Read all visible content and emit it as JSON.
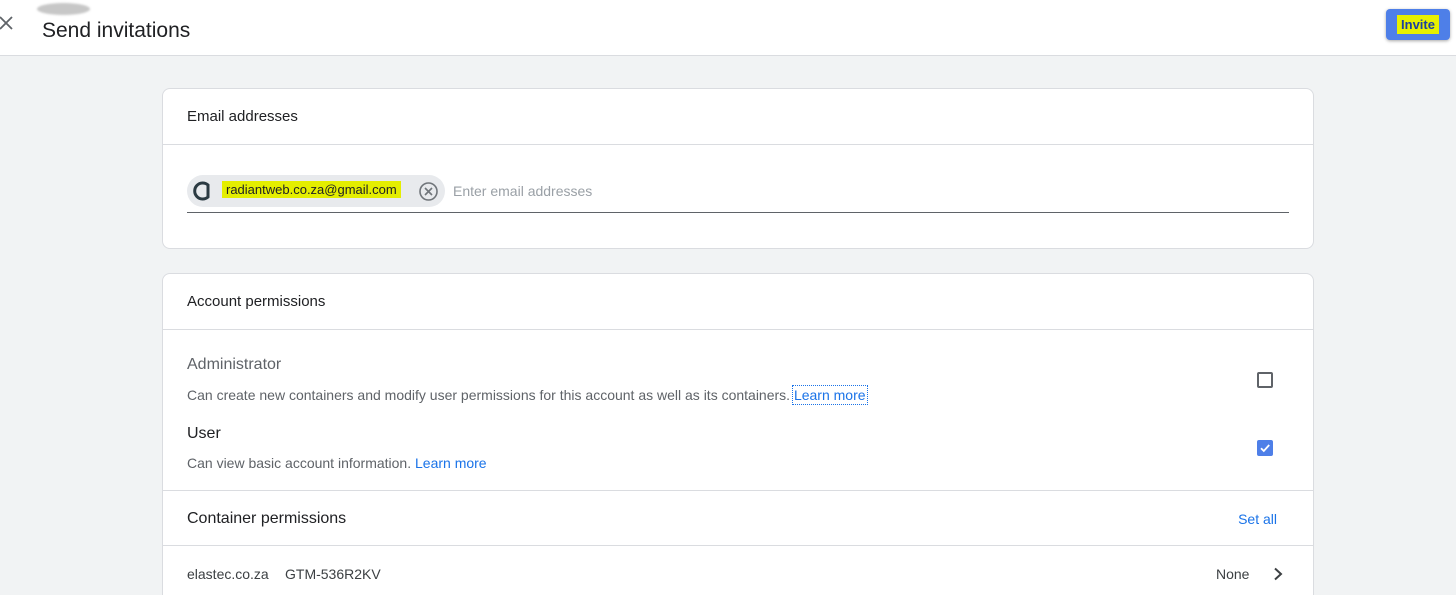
{
  "header": {
    "title": "Send invitations",
    "invite_label": "Invite"
  },
  "email_card": {
    "title": "Email addresses",
    "chip_email": "radiantweb.co.za@gmail.com",
    "input_placeholder": "Enter email addresses"
  },
  "permissions_card": {
    "title": "Account permissions",
    "roles": [
      {
        "name": "Administrator",
        "description": "Can create new containers and modify user permissions for this account as well as its containers.",
        "learn_more": "Learn more",
        "checked": false
      },
      {
        "name": "User",
        "description": "Can view basic account information.",
        "learn_more": "Learn more",
        "checked": true
      }
    ],
    "container_section": {
      "title": "Container permissions",
      "set_all_label": "Set all",
      "rows": [
        {
          "name": "elastec.co.za",
          "id": "GTM-536R2KV",
          "permission": "None"
        }
      ]
    }
  },
  "colors": {
    "accent": "#4e7fe8",
    "link": "#1a73e8",
    "highlight": "#e4ee00",
    "background": "#f1f3f4"
  },
  "icons": [
    "close-icon",
    "avatar-icon",
    "remove-chip-icon",
    "check-icon",
    "chevron-right-icon"
  ]
}
